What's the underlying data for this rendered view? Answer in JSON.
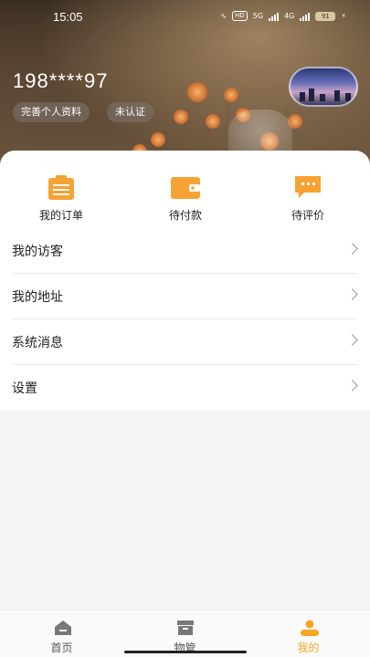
{
  "status_bar": {
    "time": "15:05",
    "hd_label": "HD",
    "net1": "5G",
    "net2": "4G",
    "battery": "91"
  },
  "profile": {
    "phone": "198****97",
    "complete_profile_label": "完善个人资料",
    "verify_status": "未认证"
  },
  "quick_actions": [
    {
      "label": "我的订单",
      "icon": "clipboard-icon"
    },
    {
      "label": "待付款",
      "icon": "wallet-icon"
    },
    {
      "label": "待评价",
      "icon": "chat-bubble-icon"
    }
  ],
  "menu": [
    {
      "label": "我的访客"
    },
    {
      "label": "我的地址"
    },
    {
      "label": "系统消息"
    },
    {
      "label": "设置"
    }
  ],
  "tabbar": [
    {
      "label": "首页",
      "icon": "home-icon",
      "active": false
    },
    {
      "label": "物管",
      "icon": "box-icon",
      "active": false
    },
    {
      "label": "我的",
      "icon": "person-icon",
      "active": true
    }
  ],
  "colors": {
    "accent": "#f5a623",
    "icon_orange": "#f7a234"
  }
}
